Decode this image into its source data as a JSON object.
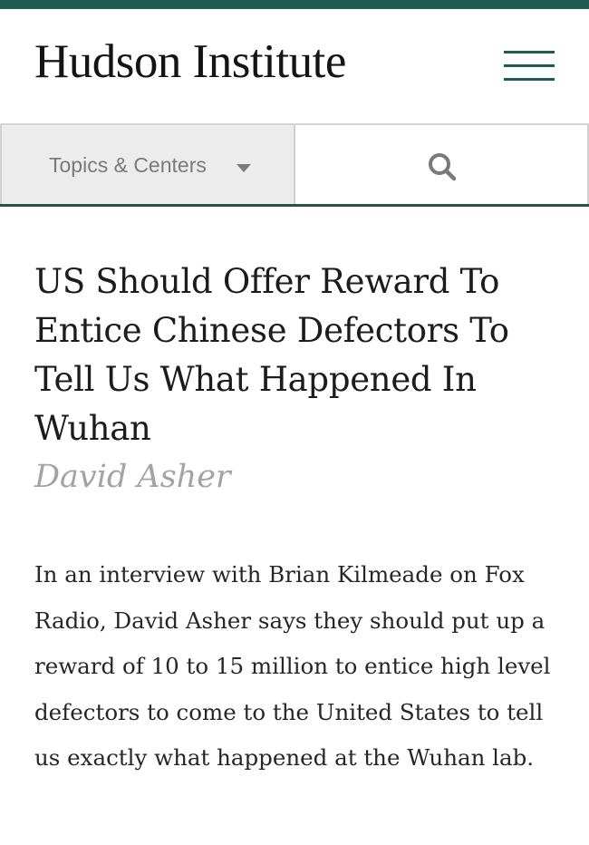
{
  "colors": {
    "accent": "#1f5b52",
    "author": "#a3a3a3",
    "nav_background": "#ececec"
  },
  "header": {
    "site_title": "Hudson Institute",
    "menu_icon": "hamburger-menu-icon"
  },
  "nav": {
    "topics_label": "Topics & Centers",
    "topics_icon": "caret-down-icon",
    "search_icon": "search-icon"
  },
  "article": {
    "title": "US Should Offer Reward To Entice Chinese Defectors To Tell Us What Happened In Wuhan",
    "author": "David Asher",
    "summary": "In an interview with Brian Kilmeade on Fox Radio, David Asher says they should put up a reward of 10 to 15 million to entice high level defectors to come to the United States to tell us exactly what happened at the Wuhan lab."
  }
}
